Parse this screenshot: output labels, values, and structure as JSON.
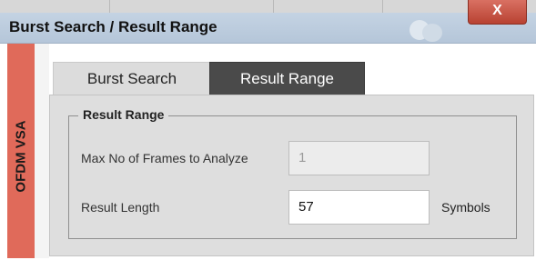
{
  "window": {
    "title": "Burst Search / Result Range",
    "close_glyph": "X"
  },
  "side_tab": {
    "label": "OFDM VSA"
  },
  "tabs": [
    {
      "label": "Burst Search",
      "active": false
    },
    {
      "label": "Result Range",
      "active": true
    }
  ],
  "group": {
    "title": "Result Range",
    "fields": [
      {
        "label": "Max No of Frames to Analyze",
        "value": "1",
        "enabled": false
      },
      {
        "label": "Result Length",
        "value": "57",
        "unit": "Symbols",
        "enabled": true
      }
    ]
  },
  "colors": {
    "titlebar": "#b5c6d9",
    "side_tab": "#e06a5a",
    "active_tab": "#4a4a4a",
    "close_button": "#c95546"
  }
}
